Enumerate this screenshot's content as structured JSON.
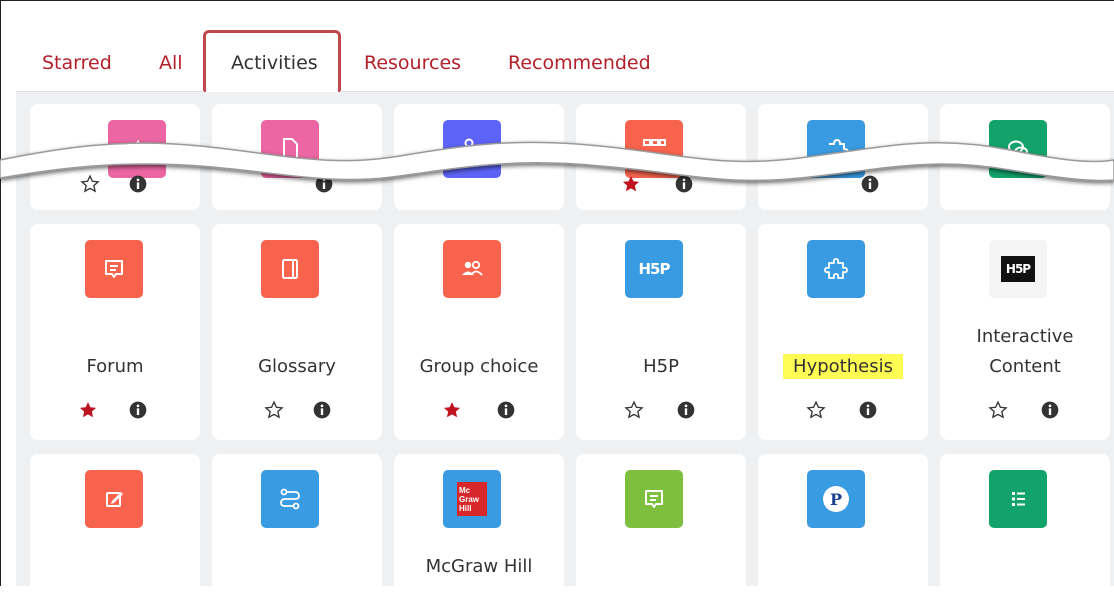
{
  "tabs": [
    {
      "label": "Starred",
      "active": false
    },
    {
      "label": "All",
      "active": false
    },
    {
      "label": "Activities",
      "active": true
    },
    {
      "label": "Resources",
      "active": false
    },
    {
      "label": "Recommended",
      "active": false
    }
  ],
  "colors": {
    "tab_link": "#b3202a",
    "tab_highlight_border": "#c0484c",
    "communication": "#f7634d",
    "collaboration": "#eb66a2",
    "interactive": "#399be2",
    "assessment": "#5d63f6",
    "content": "#7fbf40",
    "recommended": "#12a36b",
    "star_filled": "#c0121f",
    "highlight": "#fffd54"
  },
  "top_row_partial": [
    {
      "icon": "share-icon",
      "starred": false
    },
    {
      "icon": "file-icon",
      "starred": false
    },
    {
      "icon": "group-icon",
      "starred": false
    },
    {
      "icon": "grid-icon",
      "starred": true
    },
    {
      "icon": "puzzle-icon",
      "starred": false
    },
    {
      "icon": "chat-icon",
      "starred": false
    }
  ],
  "activities": [
    {
      "label": "Forum",
      "icon": "forum-icon",
      "starred": true
    },
    {
      "label": "Glossary",
      "icon": "glossary-icon",
      "starred": false
    },
    {
      "label": "Group choice",
      "icon": "group-choice-icon",
      "starred": true
    },
    {
      "label": "H5P",
      "icon": "h5p-icon",
      "starred": false
    },
    {
      "label": "Hypothesis",
      "icon": "puzzle-icon",
      "starred": false,
      "highlighted": true
    },
    {
      "label_line1": "Interactive",
      "label_line2": "Content",
      "icon": "h5p-black-icon",
      "starred": false
    }
  ],
  "bottom_row": [
    {
      "icon": "edit-icon"
    },
    {
      "icon": "path-icon"
    },
    {
      "icon": "mcgraw-hill-logo",
      "logo_text": [
        "Mc",
        "Graw",
        "Hill"
      ],
      "label": "McGraw Hill"
    },
    {
      "icon": "message-icon"
    },
    {
      "icon": "pearson-icon",
      "logo_text": "P"
    },
    {
      "icon": "list-icon"
    }
  ]
}
